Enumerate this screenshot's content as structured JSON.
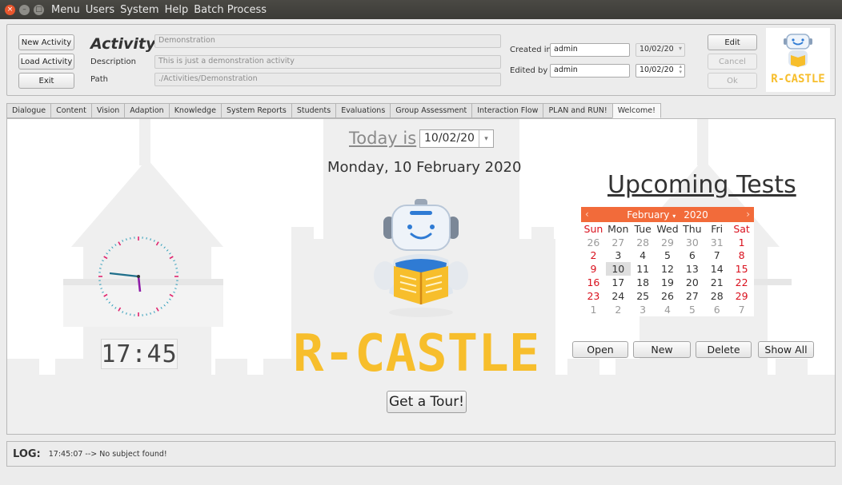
{
  "window": {
    "menu": [
      "Menu",
      "Users",
      "System",
      "Help",
      "Batch Process"
    ]
  },
  "header": {
    "new_activity": "New Activity",
    "load_activity": "Load Activity",
    "exit": "Exit",
    "title": "Activity",
    "name_value": "Demonstration",
    "description_label": "Description",
    "description_value": "This is just a demonstration activity",
    "path_label": "Path",
    "path_value": "./Activities/Demonstration",
    "created_in_label": "Created in",
    "created_in_user": "admin",
    "created_in_date": "10/02/20",
    "edited_by_label": "Edited by",
    "edited_by_user": "admin",
    "edited_by_date": "10/02/20",
    "edit": "Edit",
    "cancel": "Cancel",
    "ok": "Ok",
    "logo_text": "R-CASTLE"
  },
  "tabs": [
    "Dialogue",
    "Content",
    "Vision",
    "Adaption",
    "Knowledge",
    "System Reports",
    "Students",
    "Evaluations",
    "Group Assessment",
    "Interaction Flow",
    "PLAN and RUN!",
    "Welcome!"
  ],
  "active_tab": "Welcome!",
  "welcome": {
    "today_label": "Today is",
    "today_value": "10/02/20",
    "date_full": "Monday, 10 February 2020",
    "digital_clock": "17:45",
    "analog_clock_time": "17:45",
    "logo_text": "R-CASTLE",
    "tour_button": "Get a Tour!",
    "upcoming_title": "Upcoming Tests"
  },
  "calendar": {
    "month": "February",
    "year": "2020",
    "weekdays": [
      "Sun",
      "Mon",
      "Tue",
      "Wed",
      "Thu",
      "Fri",
      "Sat"
    ],
    "weeks": [
      [
        "26",
        "27",
        "28",
        "29",
        "30",
        "31",
        "1"
      ],
      [
        "2",
        "3",
        "4",
        "5",
        "6",
        "7",
        "8"
      ],
      [
        "9",
        "10",
        "11",
        "12",
        "13",
        "14",
        "15"
      ],
      [
        "16",
        "17",
        "18",
        "19",
        "20",
        "21",
        "22"
      ],
      [
        "23",
        "24",
        "25",
        "26",
        "27",
        "28",
        "29"
      ],
      [
        "1",
        "2",
        "3",
        "4",
        "5",
        "6",
        "7"
      ]
    ],
    "selected": "10",
    "buttons": {
      "open": "Open",
      "new": "New",
      "delete": "Delete",
      "show_all": "Show All"
    }
  },
  "log": {
    "label": "LOG:",
    "message": "17:45:07 --> No subject found!"
  },
  "colors": {
    "accent_orange": "#f26b3a",
    "weekend_red": "#d9101d",
    "logo_yellow": "#f7be2c",
    "robot_blue": "#2f7bd4"
  }
}
